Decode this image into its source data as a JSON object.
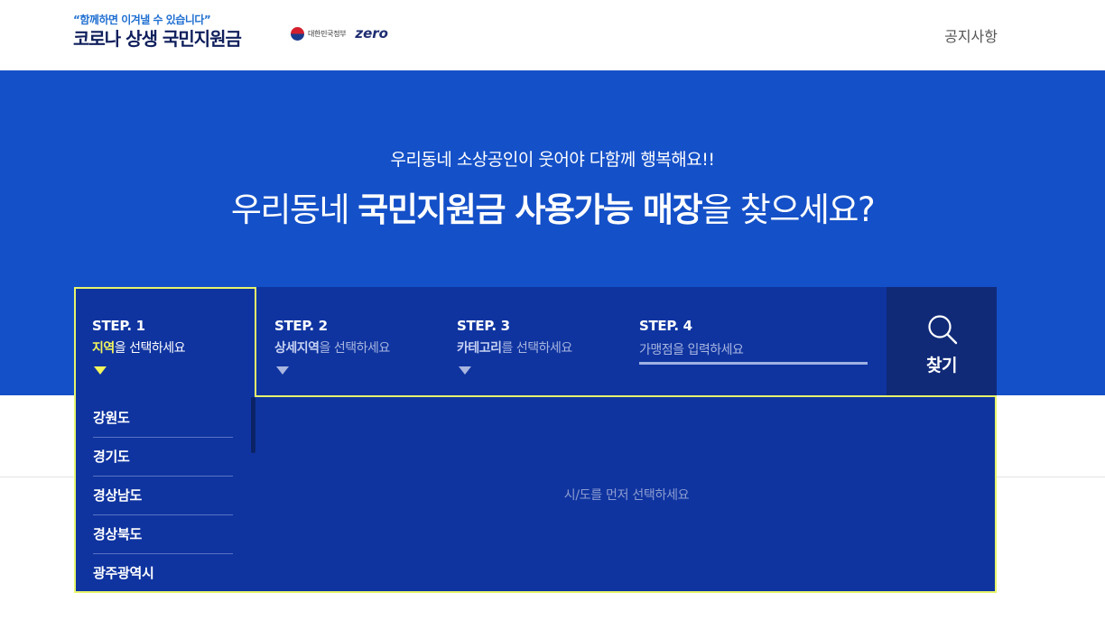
{
  "header": {
    "slogan": "“함께하면 이겨낼 수 있습니다”",
    "title": "코로나 상생 국민지원금",
    "gov_label": "대한민국정부",
    "zero_label": "zero",
    "notice": "공지사항"
  },
  "hero": {
    "subtitle": "우리동네 소상공인이 웃어야 다함께 행복해요!!",
    "title_pre": "우리동네 ",
    "title_bold": "국민지원금 사용가능 매장",
    "title_post": "을 찾으세요?"
  },
  "steps": [
    {
      "title": "STEP. 1",
      "desc_bold": "지역",
      "desc_rest": "을 선택하세요"
    },
    {
      "title": "STEP. 2",
      "desc_bold": "상세지역",
      "desc_rest": "을 선택하세요"
    },
    {
      "title": "STEP. 3",
      "desc_bold": "카테고리",
      "desc_rest": "를 선택하세요"
    },
    {
      "title": "STEP. 4",
      "placeholder": "가맹점을 입력하세요"
    }
  ],
  "search_button": {
    "label": "찾기",
    "icon": "search-icon"
  },
  "regions": [
    "강원도",
    "경기도",
    "경상남도",
    "경상북도",
    "광주광역시"
  ],
  "empty_message": "시/도를 먼저 선택하세요",
  "colors": {
    "hero_bg": "#1450c8",
    "panel_bg": "#0f34a0",
    "highlight": "#e7f46b",
    "search_bg": "#102a78"
  }
}
